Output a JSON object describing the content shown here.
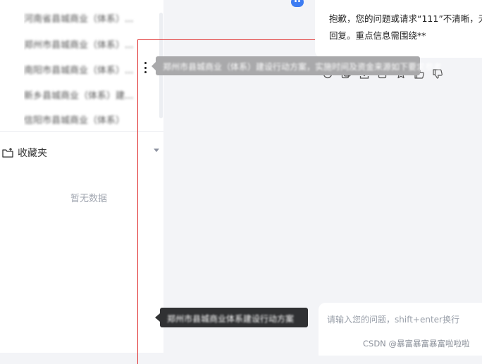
{
  "sidebar": {
    "history": [
      {
        "label": "河南省县城商业（体系）..."
      },
      {
        "label": "郑州市县城商业（体系）..."
      },
      {
        "label": "南阳市县城商业（体系）..."
      },
      {
        "label": "新乡县城商业（体系）建..."
      },
      {
        "label": "信阳市县城商业（体系）"
      }
    ],
    "favorites_label": "收藏夹",
    "favorites_empty": "暂无数据"
  },
  "chat": {
    "answer_line1": "抱歉，您的问题或请求“111”不清晰，无",
    "answer_line2": "回复。重点信息需围绕**",
    "actions": [
      "refresh-icon",
      "copy-icon",
      "download-icon",
      "share-icon",
      "star-icon",
      "thumbs-up-icon",
      "thumbs-down-icon"
    ]
  },
  "tooltips": {
    "top_text": "郑州市县城商业（体系）建设行动方案，实施时间及资金来源如下要求参考",
    "bottom_text": "郑州市县城商业体系建设行动方案"
  },
  "input": {
    "placeholder": "请输入您的问题，shift+enter换行"
  },
  "watermark": "CSDN @暴富暴富暴富啦啦啦",
  "colors": {
    "accent": "#3d7cf2",
    "highlight_border": "#e03131",
    "tooltip_dark": "#303133",
    "tooltip_light": "#a9a9ab"
  }
}
